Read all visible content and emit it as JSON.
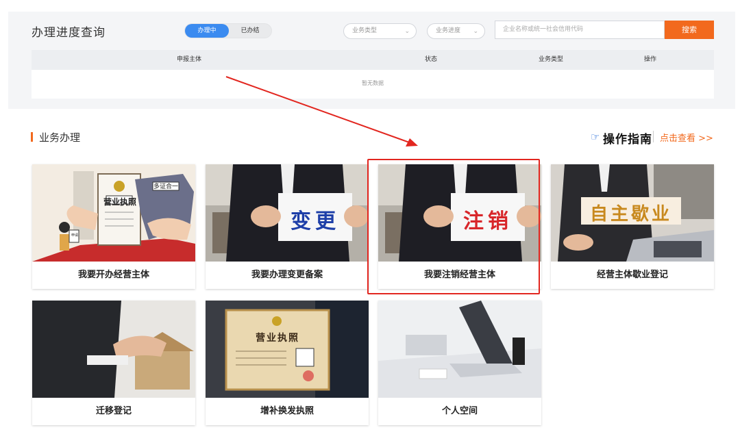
{
  "query": {
    "title": "办理进度查询",
    "tabs": [
      {
        "label": "办理中",
        "active": true
      },
      {
        "label": "已办结",
        "active": false
      }
    ],
    "business_type_select": "业务类型",
    "progress_select": "业务进度",
    "search_placeholder": "企业名称或统一社会信用代码",
    "search_button": "搜索",
    "table": {
      "headers": [
        "申报主体",
        "状态",
        "业务类型",
        "操作"
      ],
      "empty_text": "暂无数据"
    }
  },
  "services": {
    "section_title": "业务办理",
    "guide_title": "操作指南",
    "guide_link": "点击查看 >>",
    "cards": [
      {
        "label": "我要开办经营主体",
        "image_text": "营业执照",
        "badge": "多证合一",
        "sign": "申请"
      },
      {
        "label": "我要办理变更备案",
        "image_text": "变更"
      },
      {
        "label": "我要注销经营主体",
        "image_text": "注销"
      },
      {
        "label": "经营主体歇业登记",
        "image_text": "自主歇业"
      },
      {
        "label": "迁移登记"
      },
      {
        "label": "增补换发执照",
        "image_text": "营业执照"
      },
      {
        "label": "个人空间"
      }
    ]
  },
  "colors": {
    "accent": "#f2691d",
    "primary": "#3b8bf0",
    "highlight": "#e2261f",
    "guide_icon": "#2b6fd8"
  }
}
